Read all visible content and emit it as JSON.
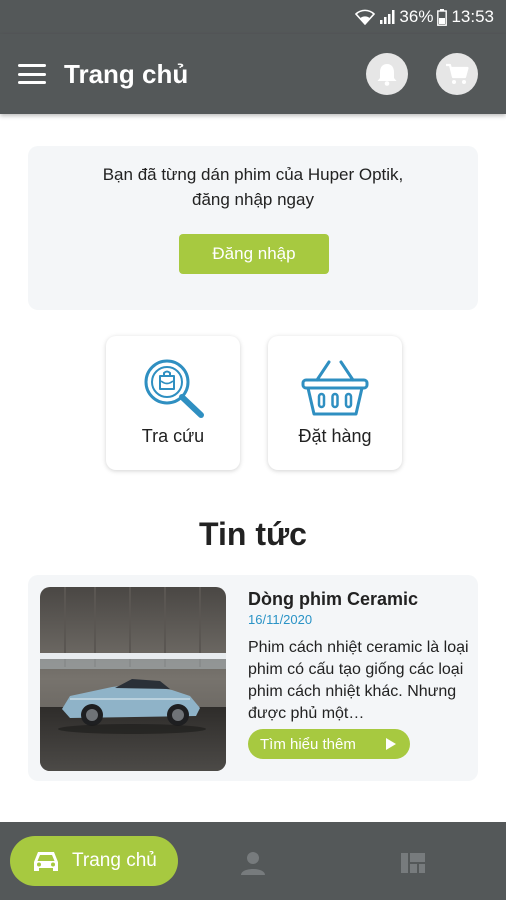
{
  "status_bar": {
    "battery": "36%",
    "time": "13:53"
  },
  "app_bar": {
    "title": "Trang chủ",
    "icons": [
      "menu-icon",
      "bell-icon",
      "cart-icon"
    ]
  },
  "login_card": {
    "message_line1": "Bạn đã từng dán phim của Huper Optik,",
    "message_line2": "đăng nhập ngay",
    "button_label": "Đăng nhập"
  },
  "quick_actions": [
    {
      "label": "Tra cứu",
      "icon": "search-lookup-icon"
    },
    {
      "label": "Đặt hàng",
      "icon": "basket-icon"
    }
  ],
  "news": {
    "section_title": "Tin tức",
    "items": [
      {
        "title": "Dòng phim Ceramic",
        "date": "16/11/2020",
        "excerpt": "Phim cách nhiệt ceramic là loại phim có cấu tạo giống các loại phim cách nhiệt khác. Nhưng được phủ một…",
        "button_label": "Tìm hiểu thêm"
      }
    ]
  },
  "bottom_nav": {
    "items": [
      {
        "label": "Trang chủ",
        "icon": "car-icon",
        "active": true
      },
      {
        "label": "",
        "icon": "person-icon",
        "active": false
      },
      {
        "label": "",
        "icon": "dashboard-icon",
        "active": false
      }
    ]
  },
  "colors": {
    "bar": "#545859",
    "accent": "#a7c940",
    "card_bg": "#f4f6f8",
    "date": "#2a93c6",
    "icon_blue": "#2f8fc1"
  }
}
